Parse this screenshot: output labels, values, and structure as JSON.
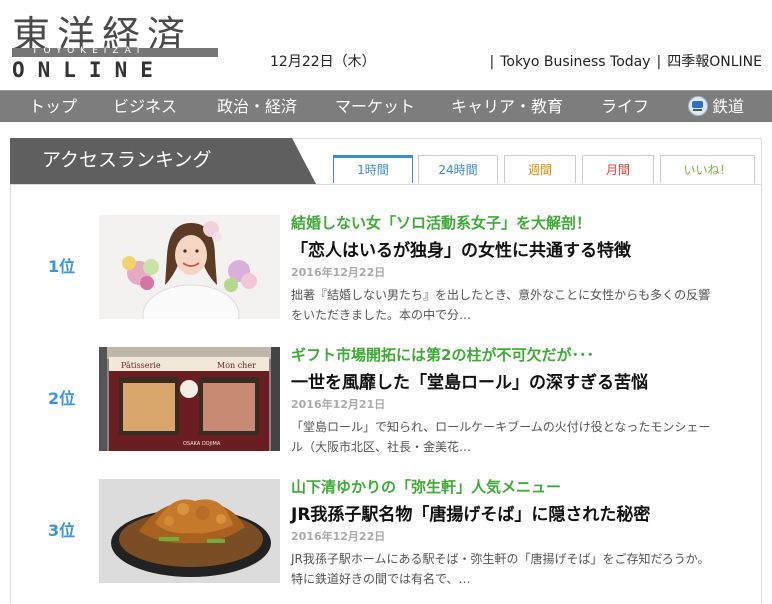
{
  "header": {
    "logo_main": "東洋経済",
    "logo_sub": "TOYOKEIZAI",
    "logo_online": "ONLINE",
    "date": "12月22日（木）",
    "links": [
      "Tokyo Business Today",
      "四季報ONLINE"
    ]
  },
  "nav": {
    "items": [
      "トップ",
      "ビジネス",
      "政治・経済",
      "マーケット",
      "キャリア・教育",
      "ライフ",
      "鉄道"
    ]
  },
  "ranking": {
    "title": "アクセスランキング",
    "tabs": [
      {
        "label": "1時間",
        "color": "#3c8ccf"
      },
      {
        "label": "24時間",
        "color": "#3c8ccf"
      },
      {
        "label": "週間",
        "color": "#e08a00"
      },
      {
        "label": "月間",
        "color": "#d9433b"
      },
      {
        "label": "いいね！",
        "color": "#7cb342"
      }
    ],
    "active_tab": "1時間",
    "items": [
      {
        "rank": "1位",
        "sub": "結婚しない女「ソロ活動系女子」を大解剖！",
        "headline": "「恋人はいるが独身」の女性に共通する特徴",
        "date": "2016年12月22日",
        "excerpt": "拙著『結婚しない男たち』を出したとき、意外なことに女性からも多くの反響をいただきました。本の中で分…"
      },
      {
        "rank": "2位",
        "sub": "ギフト市場開拓には第2の柱が不可欠だが･･･",
        "headline": "一世を風靡した「堂島ロール」の深すぎる苦悩",
        "date": "2016年12月21日",
        "excerpt": "「堂島ロール」で知られ、ロールケーキブームの火付け役となったモンシェール（大阪市北区、社長・金美花…",
        "image_text": [
          "Pâtisserie",
          "Mon cher",
          "OSAKA DOJIMA"
        ]
      },
      {
        "rank": "3位",
        "sub": "山下清ゆかりの「弥生軒」人気メニュー",
        "headline": "JR我孫子駅名物「唐揚げそば」に隠された秘密",
        "date": "2016年12月22日",
        "excerpt": "JR我孫子駅ホームにある駅そば・弥生軒の「唐揚げそば」をご存知だろうか。特に鉄道好きの間では有名で、…"
      }
    ]
  }
}
